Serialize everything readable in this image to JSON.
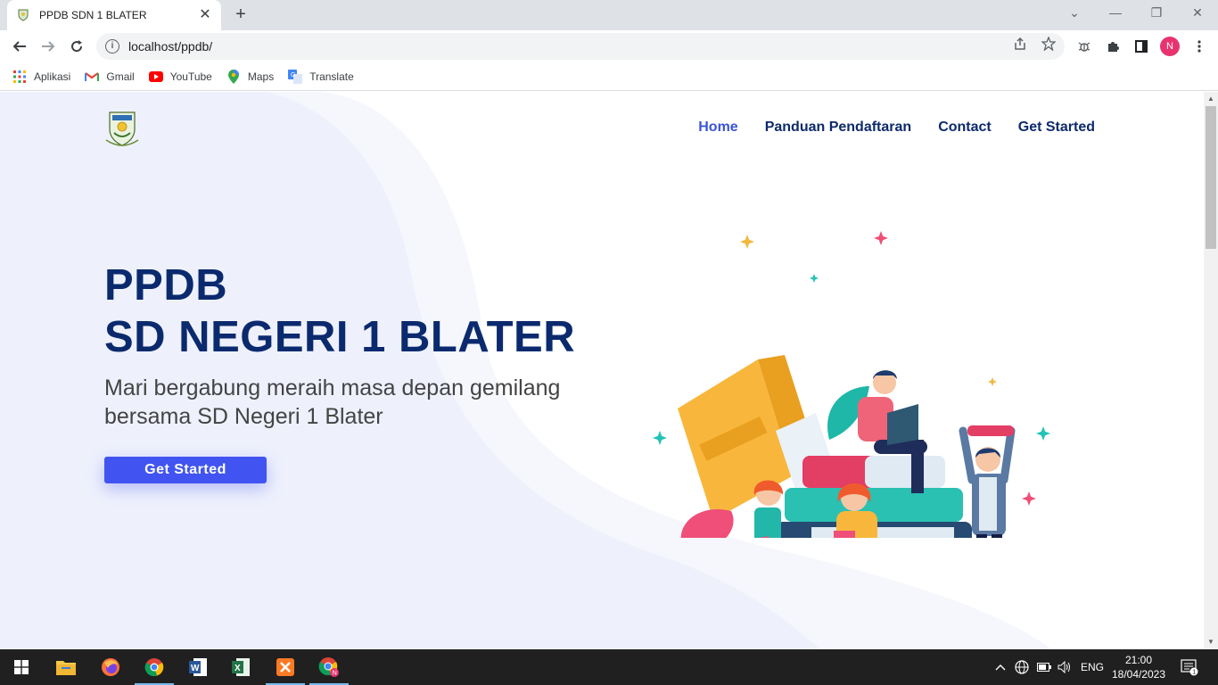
{
  "browser": {
    "tab_title": "PPDB SDN 1 BLATER",
    "url": "localhost/ppdb/",
    "profile_initial": "N",
    "bookmarks": [
      {
        "label": "Aplikasi",
        "icon": "apps-grid-icon"
      },
      {
        "label": "Gmail",
        "icon": "gmail-icon"
      },
      {
        "label": "YouTube",
        "icon": "youtube-icon"
      },
      {
        "label": "Maps",
        "icon": "maps-icon"
      },
      {
        "label": "Translate",
        "icon": "translate-icon"
      }
    ]
  },
  "page": {
    "nav": {
      "items": [
        {
          "label": "Home",
          "active": true
        },
        {
          "label": "Panduan Pendaftaran",
          "active": false
        },
        {
          "label": "Contact",
          "active": false
        },
        {
          "label": "Get Started",
          "active": false
        }
      ]
    },
    "hero": {
      "title_line1": "PPDB",
      "title_line2": "SD NEGERI 1 BLATER",
      "subtitle_line1": "Mari bergabung meraih masa depan gemilang",
      "subtitle_line2": "bersama SD Negeri 1 Blater",
      "cta_label": "Get Started"
    },
    "colors": {
      "primary": "#4154f1",
      "heading": "#0b2a6e",
      "nav_active": "#3b54d6"
    }
  },
  "taskbar": {
    "language": "ENG",
    "time": "21:00",
    "date": "18/04/2023",
    "notification_count": "1"
  }
}
